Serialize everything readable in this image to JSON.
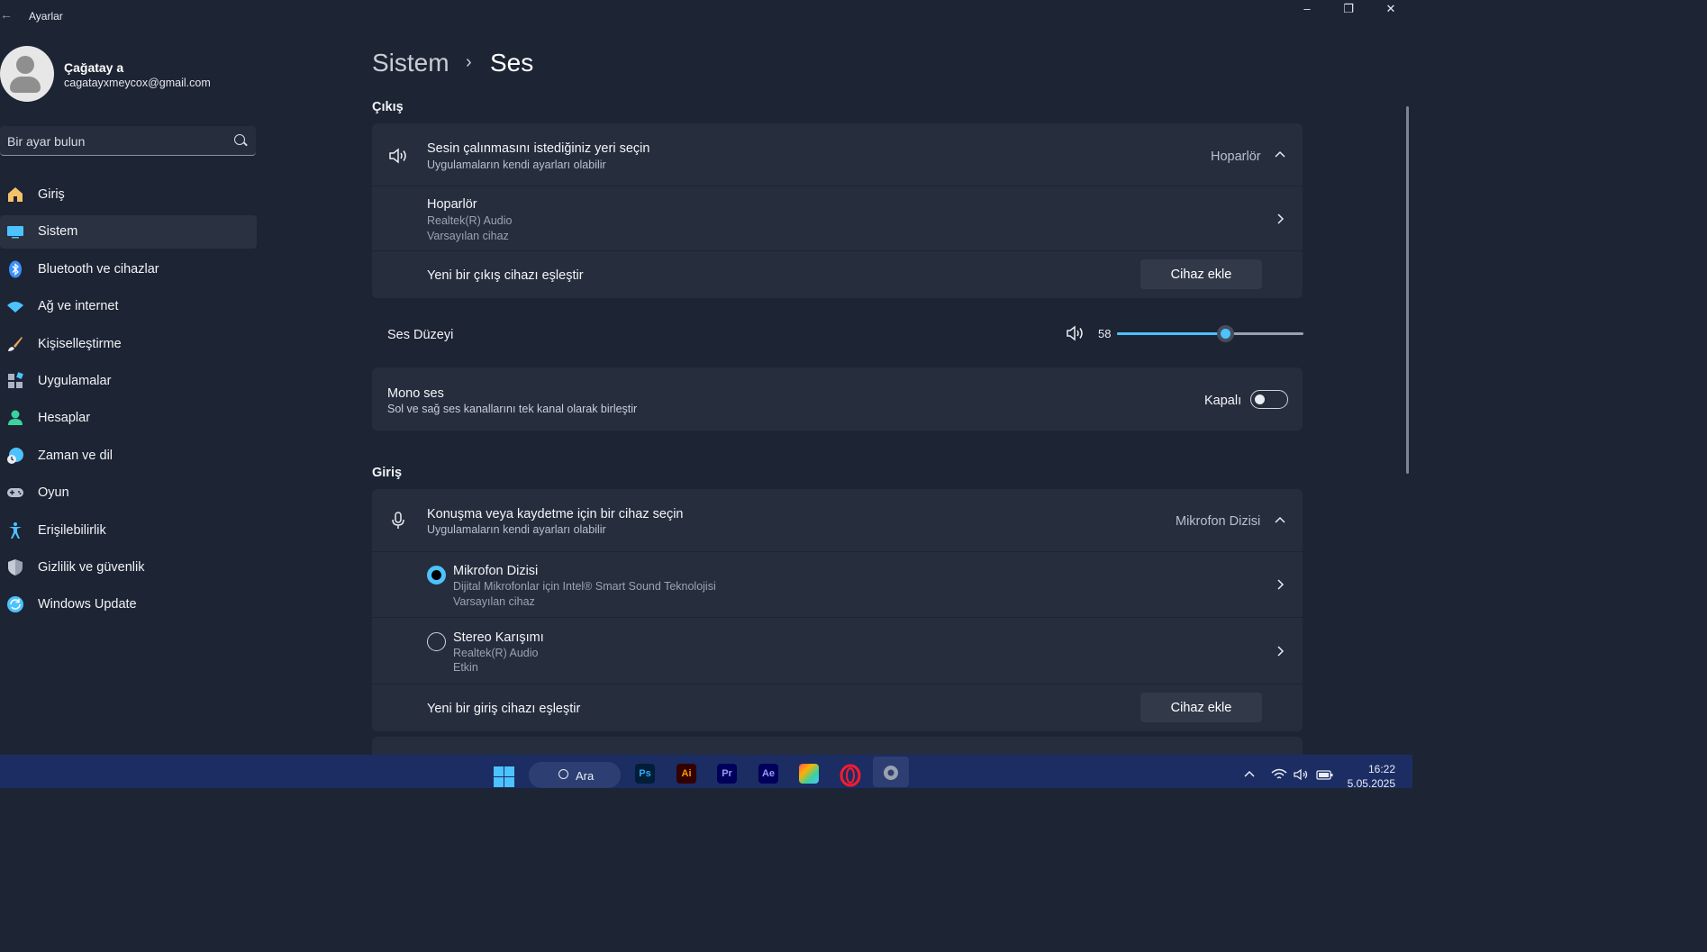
{
  "app": {
    "title": "Ayarlar"
  },
  "user": {
    "name": "Çağatay a",
    "email": "cagatayxmeycox@gmail.com"
  },
  "search": {
    "placeholder": "Bir ayar bulun"
  },
  "nav": [
    {
      "label": "Giriş",
      "icon": "home-icon",
      "color": "#f3c26b"
    },
    {
      "label": "Sistem",
      "icon": "monitor-icon",
      "color": "#4cc2ff",
      "selected": true
    },
    {
      "label": "Bluetooth ve cihazlar",
      "icon": "bluetooth-icon",
      "color": "#3a8fff"
    },
    {
      "label": "Ağ ve internet",
      "icon": "wifi-icon",
      "color": "#4cc2ff"
    },
    {
      "label": "Kişiselleştirme",
      "icon": "brush-icon",
      "color": "#f0a35a"
    },
    {
      "label": "Uygulamalar",
      "icon": "apps-icon",
      "color": "#a9b4c6"
    },
    {
      "label": "Hesaplar",
      "icon": "person-icon",
      "color": "#3ad29f"
    },
    {
      "label": "Zaman ve dil",
      "icon": "globe-clock-icon",
      "color": "#4cc2ff"
    },
    {
      "label": "Oyun",
      "icon": "gamepad-icon",
      "color": "#b9c0cc"
    },
    {
      "label": "Erişilebilirlik",
      "icon": "accessibility-icon",
      "color": "#4cc2ff"
    },
    {
      "label": "Gizlilik ve güvenlik",
      "icon": "shield-icon",
      "color": "#9aa2b0"
    },
    {
      "label": "Windows Update",
      "icon": "update-icon",
      "color": "#4cc2ff"
    }
  ],
  "breadcrumb": {
    "parent": "Sistem",
    "separator": "›",
    "current": "Ses"
  },
  "output": {
    "section": "Çıkış",
    "header": {
      "title": "Sesin çalınmasını istediğiniz yeri seçin",
      "subtitle": "Uygulamaların kendi ayarları olabilir",
      "value": "Hoparlör"
    },
    "device": {
      "name": "Hoparlör",
      "driver": "Realtek(R) Audio",
      "status": "Varsayılan cihaz"
    },
    "pair": {
      "label": "Yeni bir çıkış cihazı eşleştir",
      "button": "Cihaz ekle"
    }
  },
  "volume": {
    "label": "Ses Düzeyi",
    "value": "58",
    "level": 0.58
  },
  "mono": {
    "title": "Mono ses",
    "subtitle": "Sol ve sağ ses kanallarını tek kanal olarak birleştir",
    "state": "Kapalı"
  },
  "input": {
    "section": "Giriş",
    "header": {
      "title": "Konuşma veya kaydetme için bir cihaz seçin",
      "subtitle": "Uygulamaların kendi ayarları olabilir",
      "value": "Mikrofon Dizisi"
    },
    "devices": [
      {
        "name": "Mikrofon Dizisi",
        "driver": "Dijital Mikrofonlar için Intel® Smart Sound Teknolojisi",
        "status": "Varsayılan cihaz",
        "selected": true
      },
      {
        "name": "Stereo Karışımı",
        "driver": "Realtek(R) Audio",
        "status": "Etkin",
        "selected": false
      }
    ],
    "pair": {
      "label": "Yeni bir giriş cihazı eşleştir",
      "button": "Cihaz ekle"
    }
  },
  "taskbar": {
    "search_label": "Ara",
    "apps": [
      {
        "label": "Ps",
        "name": "photoshop-icon",
        "bg": "#001e36",
        "fg": "#31a8ff"
      },
      {
        "label": "Ai",
        "name": "illustrator-icon",
        "bg": "#330000",
        "fg": "#ff9a00"
      },
      {
        "label": "Pr",
        "name": "premiere-icon",
        "bg": "#00005b",
        "fg": "#9999ff"
      },
      {
        "label": "Ae",
        "name": "after-effects-icon",
        "bg": "#00005b",
        "fg": "#9999ff"
      }
    ],
    "time": "16:22",
    "date": "5.05.2025"
  },
  "colors": {
    "accent": "#4cc2ff",
    "background": "#1d2433",
    "card": "#262d3c",
    "taskbar": "#1b2d63"
  }
}
